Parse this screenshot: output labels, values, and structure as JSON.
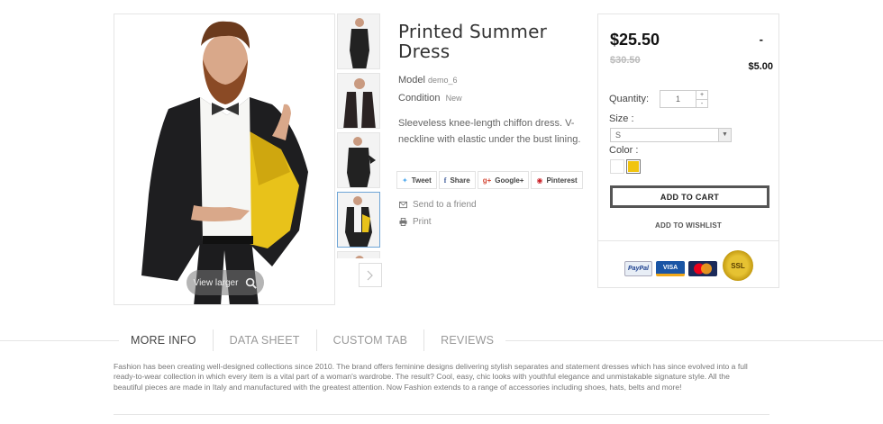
{
  "gallery": {
    "view_larger_label": "View larger",
    "thumbnail_count": 5,
    "active_thumbnail": 4
  },
  "product": {
    "title": "Printed Summer Dress",
    "model_label": "Model",
    "model_value": "demo_6",
    "condition_label": "Condition",
    "condition_value": "New",
    "description": "Sleeveless knee-length chiffon dress. V-neckline with elastic under the bust lining."
  },
  "share": {
    "tweet": "Tweet",
    "share": "Share",
    "google": "Google+",
    "pinterest": "Pinterest"
  },
  "links": {
    "send_friend": "Send to a friend",
    "print": "Print"
  },
  "buybox": {
    "price": "$25.50",
    "dash": "-",
    "old_price": "$30.50",
    "reduction": "$5.00",
    "quantity_label": "Quantity:",
    "quantity_value": "1",
    "size_label": "Size :",
    "size_value": "S",
    "color_label": "Color :",
    "colors": [
      "#ffffff",
      "#f1c40f"
    ],
    "selected_color": "#f1c40f",
    "add_to_cart": "ADD TO CART",
    "add_to_wishlist": "ADD TO WISHLIST"
  },
  "payments": {
    "paypal": "PayPal",
    "visa": "VISA",
    "mastercard": "MasterCard",
    "ssl": "SSL"
  },
  "tabs": [
    "MORE INFO",
    "DATA SHEET",
    "CUSTOM TAB",
    "REVIEWS"
  ],
  "active_tab": "MORE INFO",
  "more_info_text": "Fashion has been creating well-designed collections since 2010. The brand offers feminine designs delivering stylish separates and statement dresses which has since evolved into a full ready-to-wear collection in which every item is a vital part of a woman's wardrobe. The result? Cool, easy, chic looks with youthful elegance and unmistakable signature style. All the beautiful pieces are made in Italy and manufactured with the greatest attention. Now Fashion extends to a range of accessories including shoes, hats, belts and more!"
}
